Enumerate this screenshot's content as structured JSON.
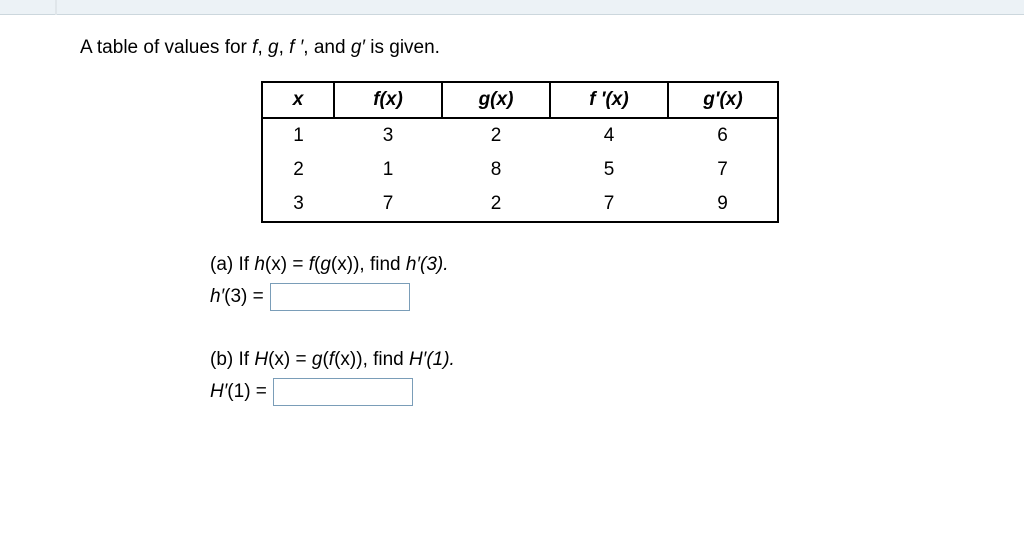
{
  "intro": {
    "prefix": "A table of values for ",
    "f": "f",
    "sep1": ", ",
    "g": "g",
    "sep2": ", ",
    "fp": "f ′",
    "sep3": ", and ",
    "gp": "g′",
    "suffix": " is given."
  },
  "table": {
    "headers": {
      "x": "x",
      "fx": "f(x)",
      "gx": "g(x)",
      "fpx": "f ′(x)",
      "gpx": "g′(x)"
    },
    "rows": [
      {
        "x": "1",
        "fx": "3",
        "gx": "2",
        "fpx": "4",
        "gpx": "6"
      },
      {
        "x": "2",
        "fx": "1",
        "gx": "8",
        "fpx": "5",
        "gpx": "7"
      },
      {
        "x": "3",
        "fx": "7",
        "gx": "2",
        "fpx": "7",
        "gpx": "9"
      }
    ]
  },
  "parts": {
    "a": {
      "label": "(a) If ",
      "lhs_func": "h",
      "lhs_arg": "(x)",
      "eq": " = ",
      "rhs_outer": "f",
      "rhs_open": "(",
      "rhs_inner": "g",
      "rhs_innerarg": "(x)",
      "rhs_close": ")",
      "tail": ", find ",
      "target": "h′(3).",
      "answer_label_func": "h′",
      "answer_label_arg": "(3) = "
    },
    "b": {
      "label": "(b) If  ",
      "lhs_func": "H",
      "lhs_arg": "(x)",
      "eq": " = ",
      "rhs_outer": "g",
      "rhs_open": "(",
      "rhs_inner": "f",
      "rhs_innerarg": "(x)",
      "rhs_close": ")",
      "tail": ", find ",
      "target": "H′(1).",
      "answer_label_func": "H′",
      "answer_label_arg": "(1) = "
    }
  },
  "chart_data": {
    "type": "table",
    "columns": [
      "x",
      "f(x)",
      "g(x)",
      "f ′(x)",
      "g′(x)"
    ],
    "rows": [
      [
        1,
        3,
        2,
        4,
        6
      ],
      [
        2,
        1,
        8,
        5,
        7
      ],
      [
        3,
        7,
        2,
        7,
        9
      ]
    ]
  }
}
